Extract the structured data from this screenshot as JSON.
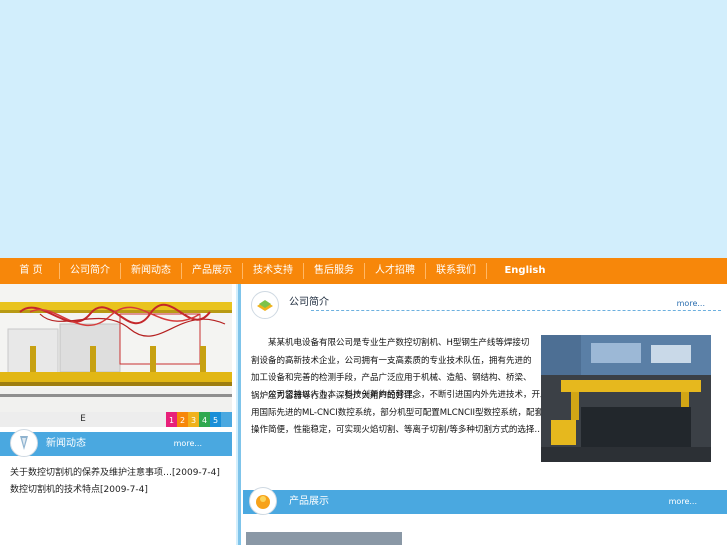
{
  "nav": {
    "items": [
      "首 页",
      "公司简介",
      "新闻动态",
      "产品展示",
      "技术支持",
      "售后服务",
      "人才招聘",
      "联系我们",
      "English"
    ]
  },
  "slideshow": {
    "caption": "E",
    "numbers": [
      "1",
      "2",
      "3",
      "4",
      "5"
    ],
    "number_colors": [
      "#e8207a",
      "#f7870a",
      "#f0b21c",
      "#2fa84f",
      "#1a8fd8"
    ]
  },
  "news": {
    "title": "新闻动态",
    "more": "more...",
    "items": [
      {
        "text": "关于数控切割机的保养及维护注意事项…",
        "date": "[2009-7-4]"
      },
      {
        "text": "数控切割机的技术特点",
        "date": "[2009-7-4]"
      }
    ]
  },
  "intro": {
    "title": "公司简介",
    "more": "more...",
    "para1": "某某机电设备有限公司是专业生产数控切割机、H型钢生产线等焊接切割设备的高新技术企业，公司拥有一支高素质的专业技术队伍，拥有先进的加工设备和完善的检测手段，产品广泛应用于机械、造船、钢结构、桥梁、锅炉压力容器等行业，深受广大用户的好评。",
    "para2": "公司坚持以人为本、科技创新的经营理念，不断引进国内外先进技术，开发出多种型号的数控切割设备，公司产品采用国际先进的ML-CNCI数控系统，部分机型可配置MLCNCII型数控系统，配套使用全中文自动套料编程软件CAD/CAM，操作简便，性能稳定，可实现火焰切割、等离子切割/等多种切割方式的选择…"
  },
  "products": {
    "title": "产品展示",
    "more": "more..."
  }
}
